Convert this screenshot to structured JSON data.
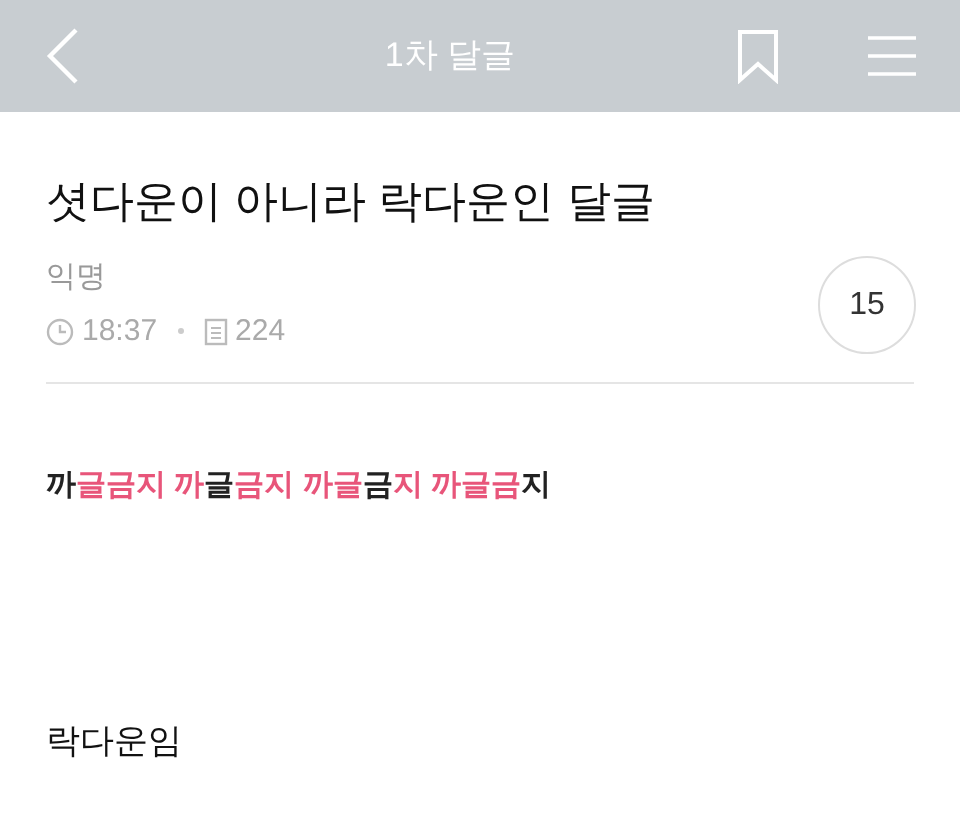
{
  "header": {
    "title": "1차 달글"
  },
  "post": {
    "title": "셧다운이 아니라 락다운인 달글",
    "author": "익명",
    "time": "18:37",
    "views": "224",
    "comment_count": "15"
  },
  "body": {
    "highlight_line": [
      {
        "text": "까",
        "color": "#222222"
      },
      {
        "text": "글금지 까",
        "color": "#e8557a"
      },
      {
        "text": "글",
        "color": "#222222"
      },
      {
        "text": "금지 까글",
        "color": "#e8557a"
      },
      {
        "text": "금",
        "color": "#222222"
      },
      {
        "text": "지 까글금",
        "color": "#e8557a"
      },
      {
        "text": "지",
        "color": "#222222"
      }
    ],
    "paragraph": "락다운임"
  }
}
